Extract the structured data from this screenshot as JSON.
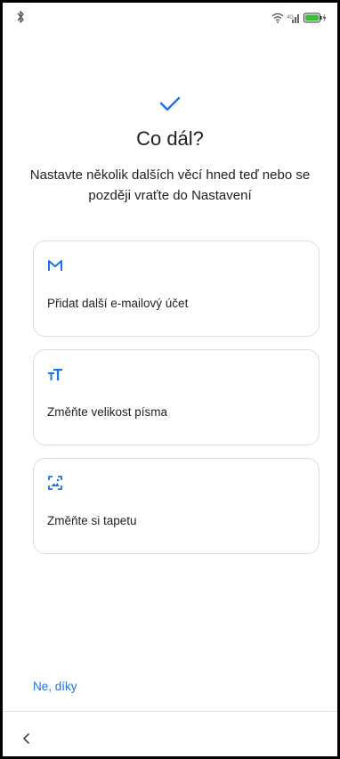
{
  "status_bar": {
    "left_icon": "bluetooth-icon",
    "right_icons": [
      "wifi-icon",
      "signal-icon",
      "battery-charging-icon"
    ],
    "battery_color": "#3bbf3b"
  },
  "header": {
    "icon": "check-icon",
    "accent_color": "#1a73e8",
    "title": "Co dál?",
    "subtitle": "Nastavte několik dalších věcí hned teď nebo se později vraťte do Nastavení"
  },
  "options": [
    {
      "icon": "gmail-icon",
      "label": "Přidat další e-mailový účet"
    },
    {
      "icon": "font-size-icon",
      "label": "Změňte velikost písma"
    },
    {
      "icon": "wallpaper-icon",
      "label": "Změňte si tapetu"
    }
  ],
  "footer": {
    "skip_label": "Ne, díky",
    "nav_icon": "back-chevron-icon"
  }
}
